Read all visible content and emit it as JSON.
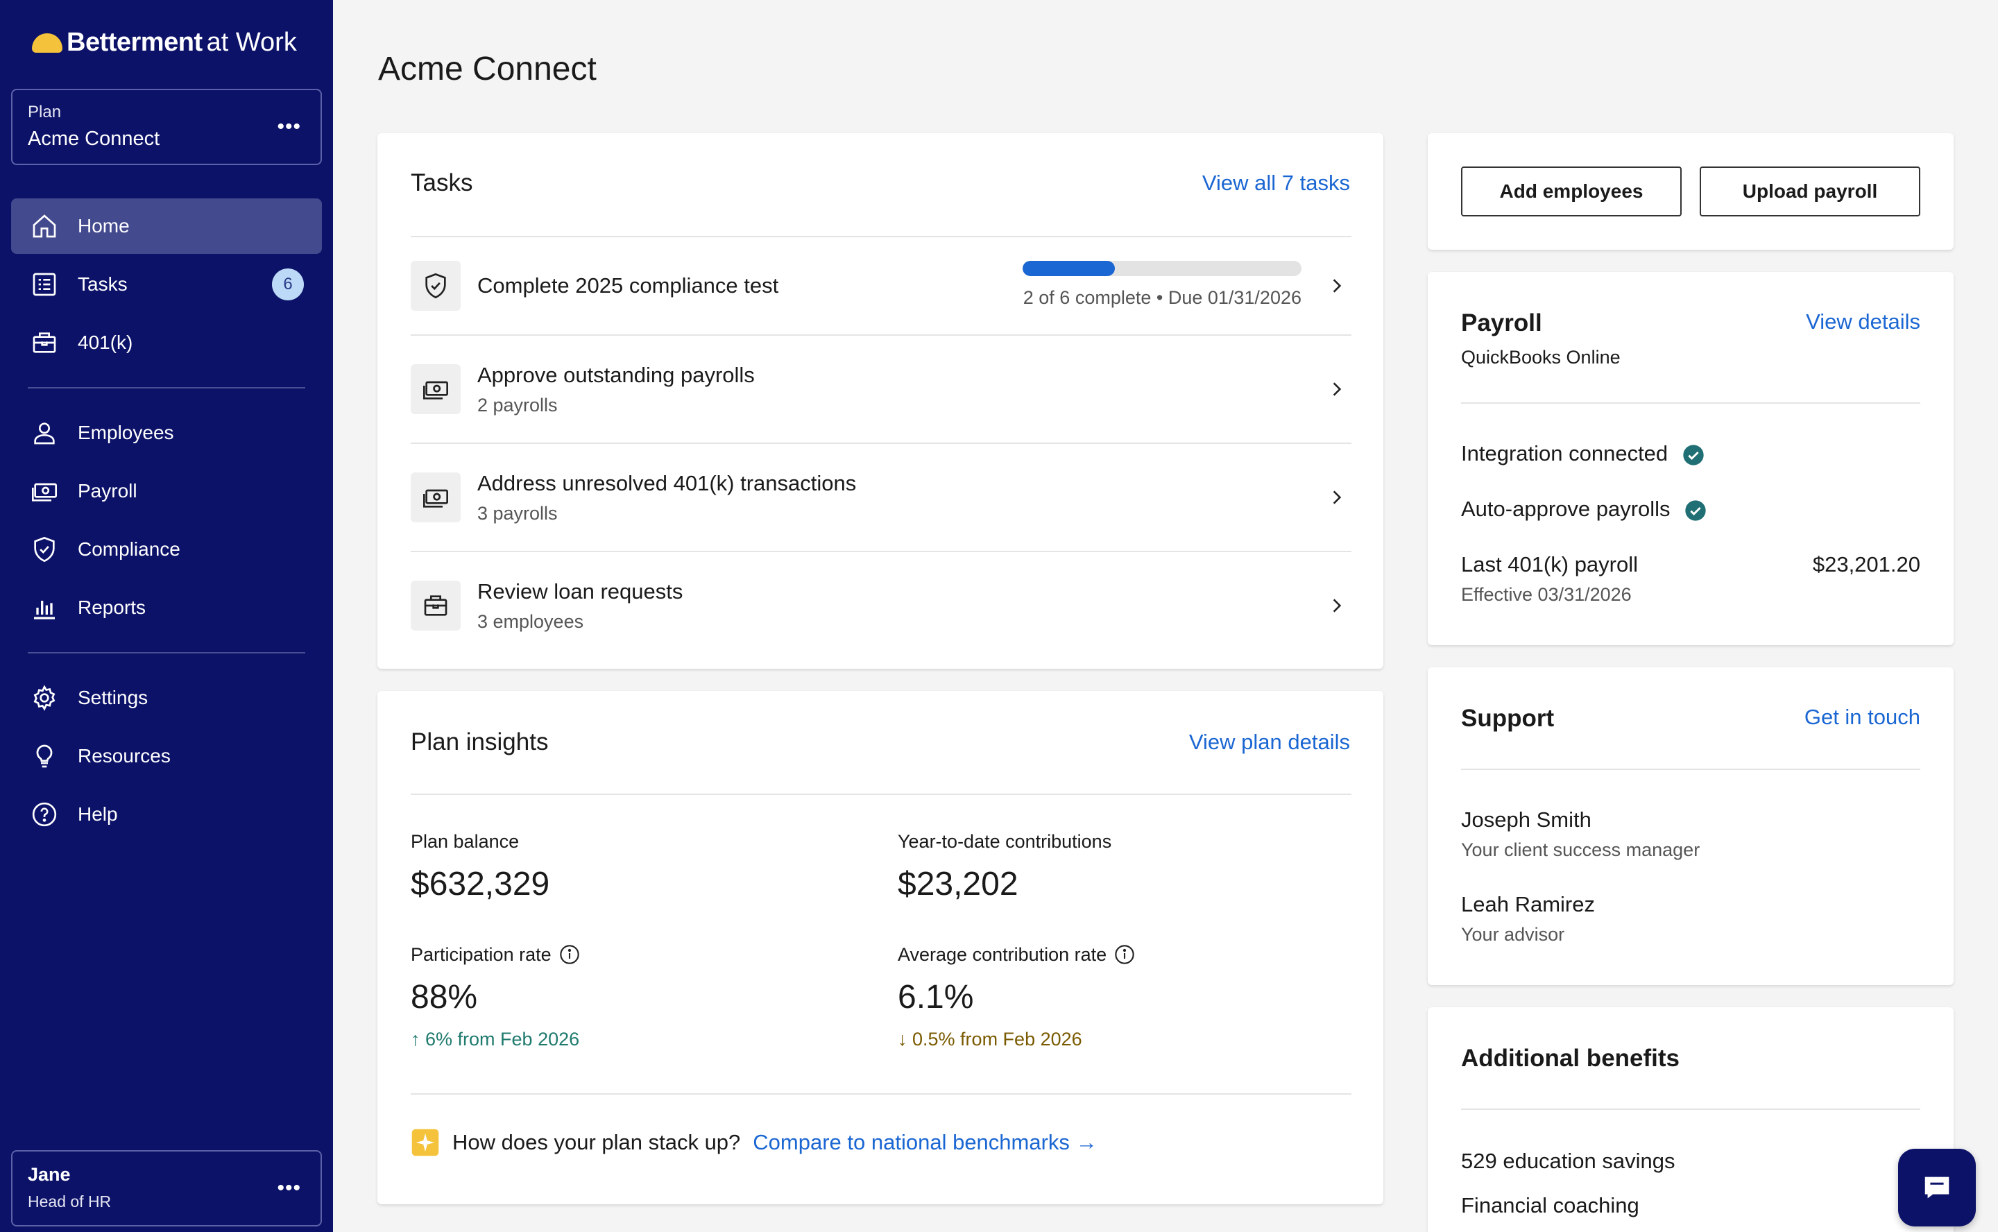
{
  "brand": {
    "name": "Betterment",
    "suffix": "at Work",
    "accent": "#f5c33b",
    "nav_bg": "#0c1268"
  },
  "plan_switcher": {
    "label": "Plan",
    "value": "Acme Connect"
  },
  "nav": {
    "home": "Home",
    "tasks": "Tasks",
    "tasks_badge": "6",
    "k401": "401(k)",
    "employees": "Employees",
    "payroll": "Payroll",
    "compliance": "Compliance",
    "reports": "Reports",
    "settings": "Settings",
    "resources": "Resources",
    "help": "Help"
  },
  "user": {
    "name": "Jane",
    "role": "Head of HR"
  },
  "page": {
    "title": "Acme Connect"
  },
  "tasks": {
    "heading": "Tasks",
    "view_all": "View all 7 tasks",
    "items": [
      {
        "title": "Complete 2025 compliance test",
        "progress_text": "2 of 6 complete • Due 01/31/2026",
        "progress": 0.33,
        "icon": "shield-check-icon"
      },
      {
        "title": "Approve outstanding payrolls",
        "sub": "2 payrolls",
        "icon": "money-icon"
      },
      {
        "title": "Address unresolved 401(k) transactions",
        "sub": "3 payrolls",
        "icon": "money-icon"
      },
      {
        "title": "Review loan requests",
        "sub": "3 employees",
        "icon": "briefcase-icon"
      }
    ]
  },
  "insights": {
    "heading": "Plan insights",
    "view_link": "View plan details",
    "plan_balance_label": "Plan balance",
    "plan_balance": "$632,329",
    "ytd_label": "Year-to-date contributions",
    "ytd": "$23,202",
    "participation_label": "Participation rate",
    "participation": "88%",
    "participation_delta": "6% from Feb 2026",
    "avg_label": "Average contribution rate",
    "avg": "6.1%",
    "avg_delta": "0.5% from Feb 2026",
    "benchmark_q": "How does your plan stack up?",
    "benchmark_link": "Compare to national benchmarks",
    "up_color": "#1f7a6e",
    "down_color": "#7a5a00"
  },
  "actions": {
    "add_employees": "Add employees",
    "upload_payroll": "Upload payroll"
  },
  "payroll": {
    "heading": "Payroll",
    "provider": "QuickBooks Online",
    "view_link": "View details",
    "integration": "Integration connected",
    "auto_approve": "Auto-approve payrolls",
    "last_label": "Last 401(k) payroll",
    "last_amount": "$23,201.20",
    "effective": "Effective 03/31/2026"
  },
  "support": {
    "heading": "Support",
    "link": "Get in touch",
    "contacts": [
      {
        "name": "Joseph Smith",
        "role": "Your client success manager"
      },
      {
        "name": "Leah Ramirez",
        "role": "Your advisor"
      }
    ]
  },
  "benefits": {
    "heading": "Additional benefits",
    "items": [
      "529 education savings",
      "Financial coaching"
    ]
  }
}
